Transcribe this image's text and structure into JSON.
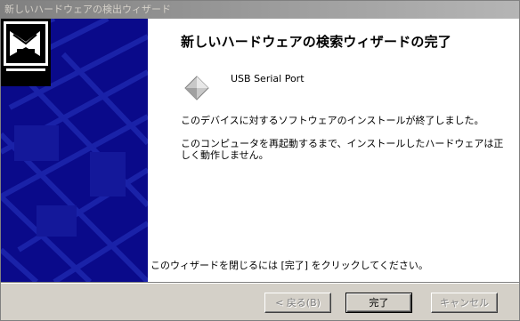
{
  "window": {
    "title": "新しいハードウェアの検出ウィザード"
  },
  "wizard": {
    "heading": "新しいハードウェアの検索ウィザードの完了",
    "device_name": "USB Serial Port",
    "message_installed": "このデバイスに対するソフトウェアのインストールが終了しました。",
    "message_restart": "このコンピュータを再起動するまで、インストールしたハードウェアは正しく動作しません。",
    "message_close": "このウィザードを閉じるには [完了] をクリックしてください。"
  },
  "buttons": {
    "back": "< 戻る(B)",
    "finish": "完了",
    "cancel": "キャンセル"
  },
  "colors": {
    "sidebar": "#0a0a8a",
    "title_text": "#d4d0c8",
    "face": "#d4d0c8"
  },
  "icons": {
    "wizard": "hardware-wizard-icon",
    "device": "device-diamond-icon"
  }
}
